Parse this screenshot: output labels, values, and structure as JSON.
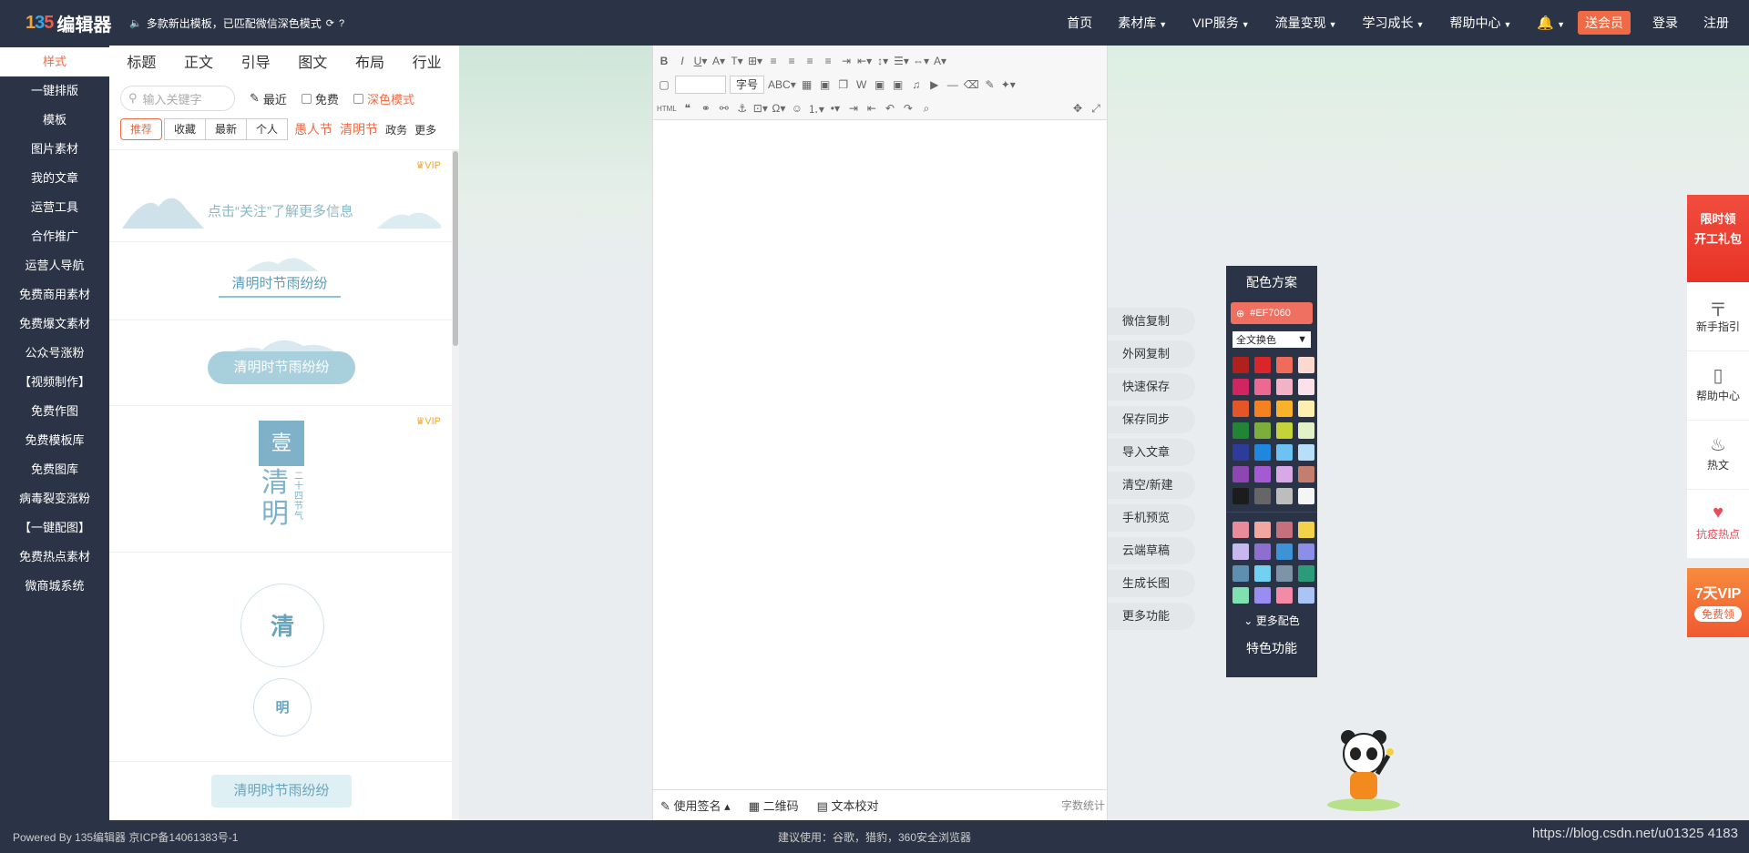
{
  "header": {
    "logo": "135编辑器",
    "notice": "多款新出模板，已匹配微信深色模式",
    "nav": [
      {
        "label": "首页",
        "dropdown": false
      },
      {
        "label": "素材库",
        "dropdown": true
      },
      {
        "label": "VIP服务",
        "dropdown": true
      },
      {
        "label": "流量变现",
        "dropdown": true
      },
      {
        "label": "学习成长",
        "dropdown": true
      },
      {
        "label": "帮助中心",
        "dropdown": true
      }
    ],
    "vip_button": "送会员",
    "login": "登录",
    "register": "注册"
  },
  "sidebar": {
    "items": [
      "样式",
      "一键排版",
      "模板",
      "图片素材",
      "我的文章",
      "运营工具",
      "合作推广",
      "运营人导航",
      "免费商用素材",
      "免费爆文素材",
      "公众号涨粉",
      "【视频制作】",
      "免费作图",
      "免费模板库",
      "免费图库",
      "病毒裂变涨粉",
      "【一键配图】",
      "免费热点素材",
      "微商城系统"
    ],
    "active_index": 0
  },
  "panel": {
    "tabs": [
      "标题",
      "正文",
      "引导",
      "图文",
      "布局",
      "行业"
    ],
    "search_placeholder": "输入关键字",
    "filter_recent": "最近",
    "filter_free": "免费",
    "filter_dark": "深色模式",
    "segments": [
      "推荐",
      "收藏",
      "最新",
      "个人"
    ],
    "festivals": [
      "愚人节",
      "清明节"
    ],
    "extra_tags": [
      "政务",
      "更多"
    ],
    "cards": {
      "vip_label": "VIP",
      "card1_text": "点击“关注”了解更多信息",
      "card2_text": "清明时节雨纷纷",
      "card3_text": "清明时节雨纷纷",
      "card4_block": "壹",
      "card4_vertical": [
        "清",
        "明"
      ],
      "card4_sub": "二十四节气",
      "card5_big": "清",
      "card5_small": "明",
      "card6_text": "清明时节雨纷纷"
    }
  },
  "editor": {
    "font_size_label": "字号",
    "footer": {
      "signature": "使用签名",
      "qrcode": "二维码",
      "proofread": "文本校对",
      "word_count": "字数统计"
    }
  },
  "actions": [
    "微信复制",
    "外网复制",
    "快速保存",
    "保存同步",
    "导入文章",
    "清空/新建",
    "手机预览",
    "云端草稿",
    "生成长图",
    "更多功能"
  ],
  "palette": {
    "title": "配色方案",
    "current_color": "#EF7060",
    "scope": "全文换色",
    "more": "更多配色",
    "feature": "特色功能",
    "swatches": [
      "#b0211d",
      "#d9262a",
      "#ef6b5a",
      "#fbd9d0",
      "#d02560",
      "#ec6a92",
      "#f3b2c6",
      "#fbe1ea",
      "#e45527",
      "#f58220",
      "#f9b22a",
      "#fcefb0",
      "#218535",
      "#7cae3a",
      "#c3d338",
      "#e3f2c6",
      "#2d3c9a",
      "#1f87dd",
      "#6cc2f3",
      "#b5e0f8",
      "#8e47b2",
      "#a65ad1",
      "#d8a9e6",
      "#c47e6e",
      "#1c1c1c",
      "#666666",
      "#bdbdbd",
      "#f5f5f5"
    ],
    "gradients": [
      "#e98b9a",
      "#f2a7a0",
      "#c7707d",
      "#f3d24a",
      "#c9b8f0",
      "#8d6fd0",
      "#3d93d6",
      "#8d8fe6",
      "#5e8fae",
      "#72d0f0",
      "#7c93a8",
      "#2c9b7a",
      "#7fe0b0",
      "#9a8cf0",
      "#f48aa6",
      "#a9c4f5"
    ]
  },
  "right_side": {
    "promo1": [
      "限时领",
      "开工礼包"
    ],
    "items": [
      {
        "icon": "guide-icon",
        "label": "新手指引"
      },
      {
        "icon": "book-icon",
        "label": "帮助中心"
      },
      {
        "icon": "fire-icon",
        "label": "热文"
      },
      {
        "icon": "heart-icon",
        "label": "抗疫热点"
      }
    ],
    "promo2_title": "7天VIP",
    "promo2_sub": "免费领"
  },
  "footer": {
    "left": "Powered By 135编辑器  京ICP备14061383号-1",
    "center": "建议使用：谷歌，猎豹，360安全浏览器",
    "right": "https://blog.csdn.net/u01325 4183"
  }
}
